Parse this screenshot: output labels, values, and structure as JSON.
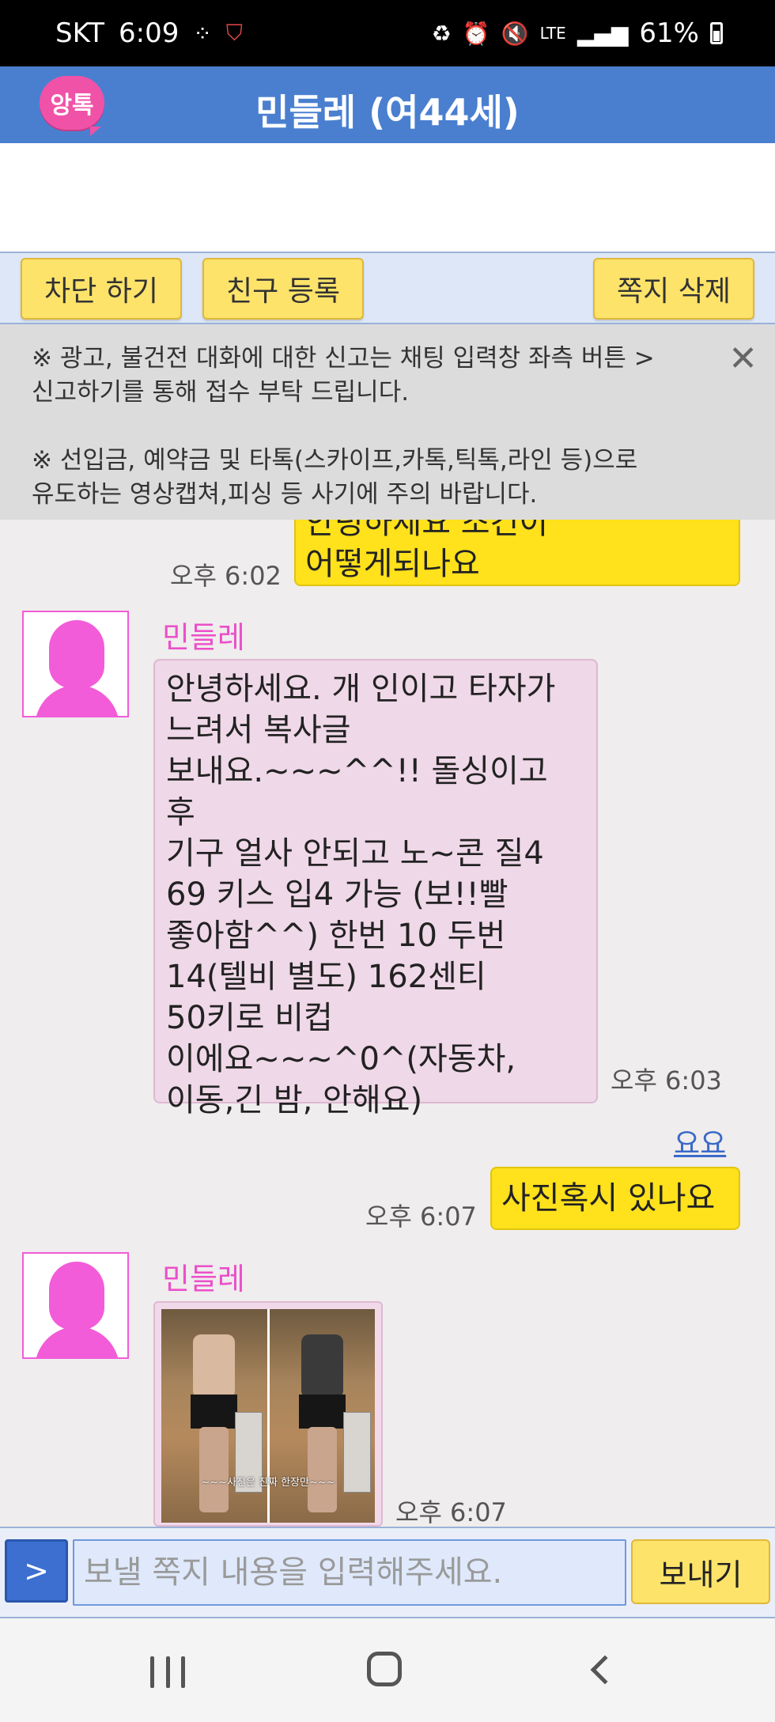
{
  "status_bar": {
    "carrier": "SKT",
    "time": "6:09",
    "battery_percent": "61%",
    "icons": [
      "grid-dots-icon",
      "shield-v-icon",
      "battery-saver-icon",
      "alarm-icon",
      "mute-icon",
      "lte-icon",
      "signal-icon",
      "battery-icon"
    ]
  },
  "header": {
    "logo_text": "앙톡",
    "title": "민들레 (여44세)"
  },
  "actions": {
    "block_label": "차단 하기",
    "friend_label": "친구 등록",
    "delete_label": "쪽지 삭제"
  },
  "notice": {
    "line1": "※ 광고, 불건전 대화에 대한 신고는 채팅 입력창 좌측 버튼 >\n신고하기를 통해 접수 부탁 드립니다.",
    "line2": "※ 선입금, 예약금 및 타톡(스카이프,카톡,틱톡,라인 등)으로\n유도하는 영상캡쳐,피싱 등 사기에 주의 바랍니다.",
    "close_icon": "close-icon"
  },
  "messages": [
    {
      "from": "me",
      "text_partial_top": "안녕하세요 조건이",
      "text": "어떻게되나요",
      "time": "오후 6:02"
    },
    {
      "from": "her",
      "name": "민들레",
      "text": "안녕하세요. 개 인이고 타자가\n느려서 복사글\n보내요.~~~^^!! 돌싱이고 후\n기구 얼사 안되고 노~콘 질4\n69 키스 입4 가능 (보!!빨\n좋아함^^) 한번 10 두번\n14(텔비 별도) 162센티\n50키로 비컵\n이에요~~~^0^(자동차,\n이동,긴 밤, 안해요)",
      "time": "오후 6:03"
    },
    {
      "from": "me",
      "nick": "요요",
      "text": "사진혹시 있나요",
      "time": "오후 6:07"
    },
    {
      "from": "her",
      "name": "민들레",
      "photo_caption": "~~~사진은 진짜 한장만~~~",
      "time": "오후 6:07"
    }
  ],
  "composer": {
    "menu_label": ">",
    "placeholder": "보낼 쪽지 내용을 입력해주세요.",
    "send_label": "보내기"
  },
  "colors": {
    "header_blue": "#4a7fd0",
    "my_bubble": "#ffe11c",
    "her_bubble": "#efd8e8",
    "name_pink": "#ec4fc9",
    "button_yellow": "#fde36a"
  }
}
